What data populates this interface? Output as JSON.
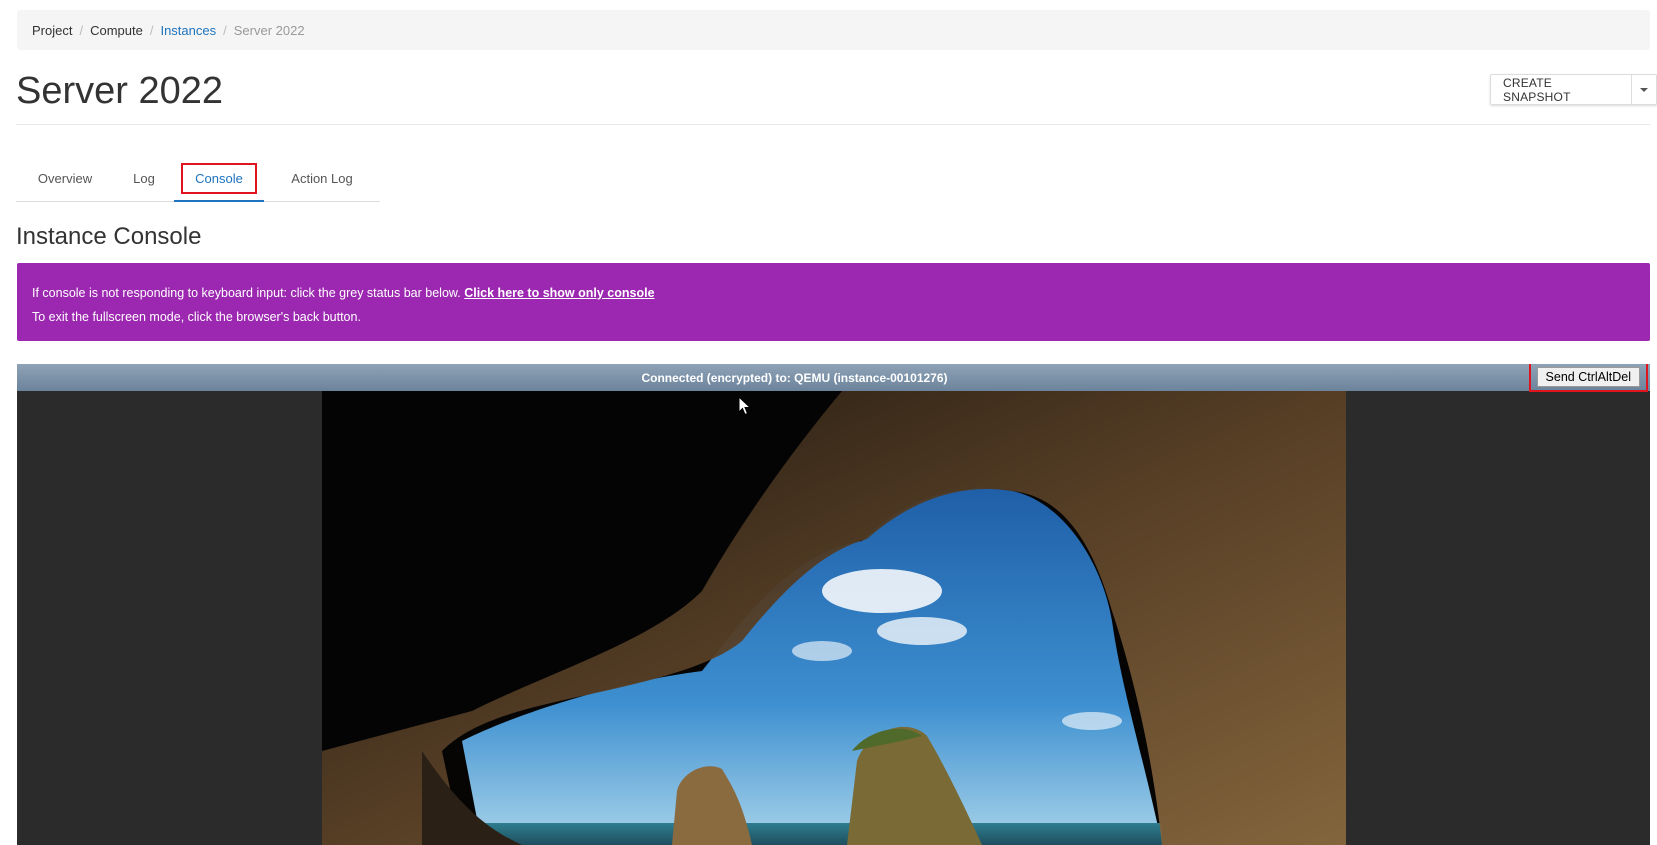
{
  "breadcrumb": {
    "project": "Project",
    "compute": "Compute",
    "instances": "Instances",
    "current": "Server 2022"
  },
  "page": {
    "title": "Server 2022",
    "snapshot_button": "CREATE SNAPSHOT"
  },
  "tabs": [
    "Overview",
    "Log",
    "Console",
    "Action Log"
  ],
  "section": {
    "title": "Instance Console"
  },
  "alert": {
    "line1": "If console is not responding to keyboard input: click the grey status bar below.",
    "link": "Click here to show only console",
    "line2": "To exit the fullscreen mode, click the browser's back button."
  },
  "console": {
    "status": "Connected (encrypted) to: QEMU (instance-00101276)",
    "ctrl_alt_del": "Send CtrlAltDel"
  },
  "colors": {
    "alert_bg": "#9c27b0",
    "link": "#1e73be",
    "highlight": "#e0141e"
  },
  "icons": [
    "chevron-down-icon",
    "mouse-pointer-icon"
  ]
}
